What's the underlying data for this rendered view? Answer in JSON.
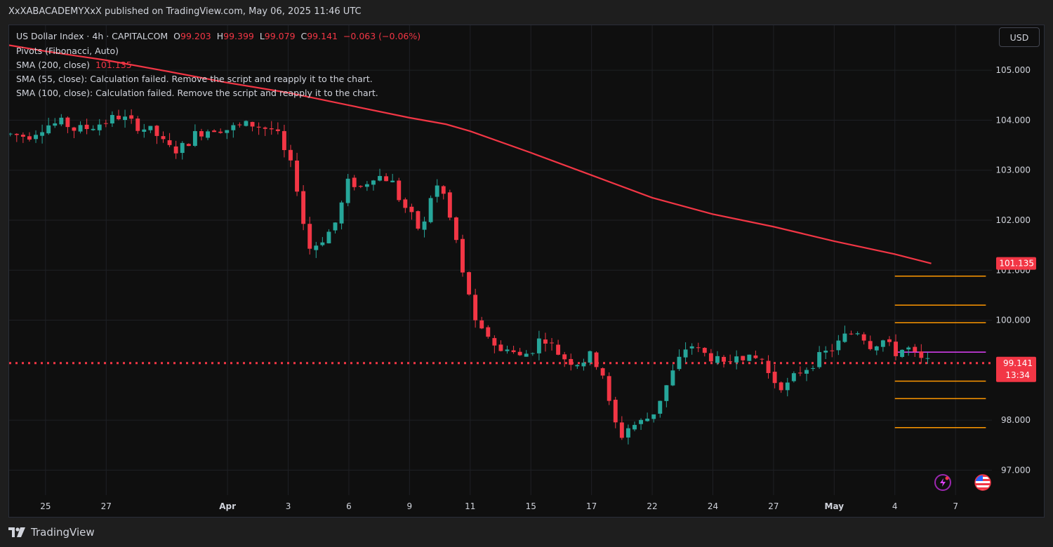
{
  "publisher": "XxXABACADEMYXxX published on TradingView.com, May 06, 2025 11:46 UTC",
  "legend": {
    "symbol": "US Dollar Index · 4h · CAPITALCOM",
    "o_label": "O",
    "o": "99.203",
    "h_label": "H",
    "h": "99.399",
    "l_label": "L",
    "l": "99.079",
    "c_label": "C",
    "c": "99.141",
    "change": "−0.063 (−0.06%)",
    "pivots": "Pivots (Fibonacci, Auto)",
    "sma200_label": "SMA (200, close)",
    "sma200_value": "101.135",
    "sma55": "SMA (55, close): Calculation failed. Remove the script and reapply it to the chart.",
    "sma100": "SMA (100, close): Calculation failed. Remove the script and reapply it to the chart."
  },
  "currency": "USD",
  "footer": "TradingView",
  "colors": {
    "up": "#26a69a",
    "down": "#f23645",
    "sma": "#f23645",
    "pivot": "#ff9800",
    "pivot_pink": "#e040fb",
    "grid": "#1f2025",
    "price_line": "#f23645"
  },
  "icons": [
    "lightning-icon",
    "us-flag-icon"
  ],
  "chart_data": {
    "type": "candlestick",
    "title": "US Dollar Index · 4h · CAPITALCOM",
    "y_ticks": [
      "105.000",
      "104.000",
      "103.000",
      "102.000",
      "101.000",
      "100.000",
      "98.000",
      "97.000"
    ],
    "ylim": [
      96.5,
      105.9
    ],
    "x_ticks": [
      {
        "label": "25",
        "x": 0
      },
      {
        "label": "27",
        "x": 10
      },
      {
        "label": "Apr",
        "x": 30,
        "bold": true
      },
      {
        "label": "3",
        "x": 40
      },
      {
        "label": "6",
        "x": 50
      },
      {
        "label": "9",
        "x": 60
      },
      {
        "label": "11",
        "x": 70
      },
      {
        "label": "15",
        "x": 80
      },
      {
        "label": "17",
        "x": 90
      },
      {
        "label": "22",
        "x": 100
      },
      {
        "label": "24",
        "x": 110
      },
      {
        "label": "27",
        "x": 120
      },
      {
        "label": "May",
        "x": 130,
        "bold": true
      },
      {
        "label": "4",
        "x": 140
      },
      {
        "label": "7",
        "x": 150
      }
    ],
    "xlim": [
      -6,
      156
    ],
    "last_price": {
      "value": 99.141,
      "label": "99.141",
      "countdown": "13:34"
    },
    "sma_badge": {
      "value": 101.135,
      "label": "101.135"
    },
    "sma200": {
      "x": [
        -6,
        0,
        10,
        20,
        30,
        40,
        50,
        60,
        66,
        70,
        80,
        90,
        100,
        110,
        120,
        130,
        140,
        146
      ],
      "y": [
        105.5,
        105.38,
        105.2,
        104.98,
        104.75,
        104.55,
        104.3,
        104.05,
        103.92,
        103.78,
        103.35,
        102.9,
        102.45,
        102.12,
        101.87,
        101.58,
        101.32,
        101.135
      ]
    },
    "pivots": [
      {
        "value": 100.88,
        "x_start": 140,
        "x_end": 155,
        "color": "orange"
      },
      {
        "value": 100.3,
        "x_start": 140,
        "x_end": 155,
        "color": "orange"
      },
      {
        "value": 99.95,
        "x_start": 140,
        "x_end": 155,
        "color": "orange"
      },
      {
        "value": 99.36,
        "x_start": 140,
        "x_end": 155,
        "color": "pink"
      },
      {
        "value": 98.78,
        "x_start": 140,
        "x_end": 155,
        "color": "orange"
      },
      {
        "value": 98.43,
        "x_start": 140,
        "x_end": 155,
        "color": "orange"
      },
      {
        "value": 97.85,
        "x_start": 140,
        "x_end": 155,
        "color": "orange"
      }
    ],
    "anchors": {
      "x": [
        -6,
        -3,
        0,
        3,
        5,
        7,
        10,
        12,
        15,
        18,
        20,
        22,
        25,
        28,
        30,
        32,
        34,
        36,
        38,
        39,
        40,
        41,
        42,
        43,
        45,
        47,
        48,
        50,
        52,
        54,
        56,
        57,
        58,
        59,
        61,
        62,
        63,
        64,
        66,
        67,
        68,
        69,
        70,
        71,
        73,
        75,
        76,
        78,
        80,
        82,
        84,
        86,
        88,
        90,
        92,
        93,
        94,
        95,
        96,
        98,
        100,
        102,
        104,
        106,
        108,
        110,
        112,
        114,
        116,
        118,
        119,
        120,
        122,
        124,
        126,
        128,
        130,
        132,
        134,
        136,
        138,
        140,
        142,
        144,
        146
      ],
      "y": [
        103.72,
        103.68,
        103.9,
        103.95,
        103.8,
        103.85,
        103.98,
        104.08,
        103.9,
        103.75,
        103.45,
        103.4,
        103.75,
        103.85,
        103.82,
        103.88,
        103.92,
        103.85,
        103.8,
        103.4,
        103.28,
        102.8,
        102.5,
        101.4,
        101.55,
        101.8,
        102.0,
        102.8,
        102.65,
        102.9,
        102.85,
        102.8,
        102.5,
        102.3,
        101.95,
        101.7,
        102.2,
        102.75,
        102.45,
        101.8,
        101.5,
        100.7,
        100.5,
        99.8,
        99.7,
        99.35,
        99.5,
        99.25,
        99.38,
        99.7,
        99.4,
        99.2,
        99.15,
        99.3,
        98.9,
        98.25,
        97.9,
        97.7,
        97.85,
        97.95,
        98.1,
        98.6,
        99.1,
        99.55,
        99.35,
        99.25,
        99.05,
        99.4,
        99.2,
        99.25,
        98.95,
        98.8,
        98.65,
        98.95,
        99.1,
        99.3,
        99.45,
        99.7,
        99.8,
        99.5,
        99.6,
        99.35,
        99.45,
        99.2,
        99.14
      ]
    }
  }
}
